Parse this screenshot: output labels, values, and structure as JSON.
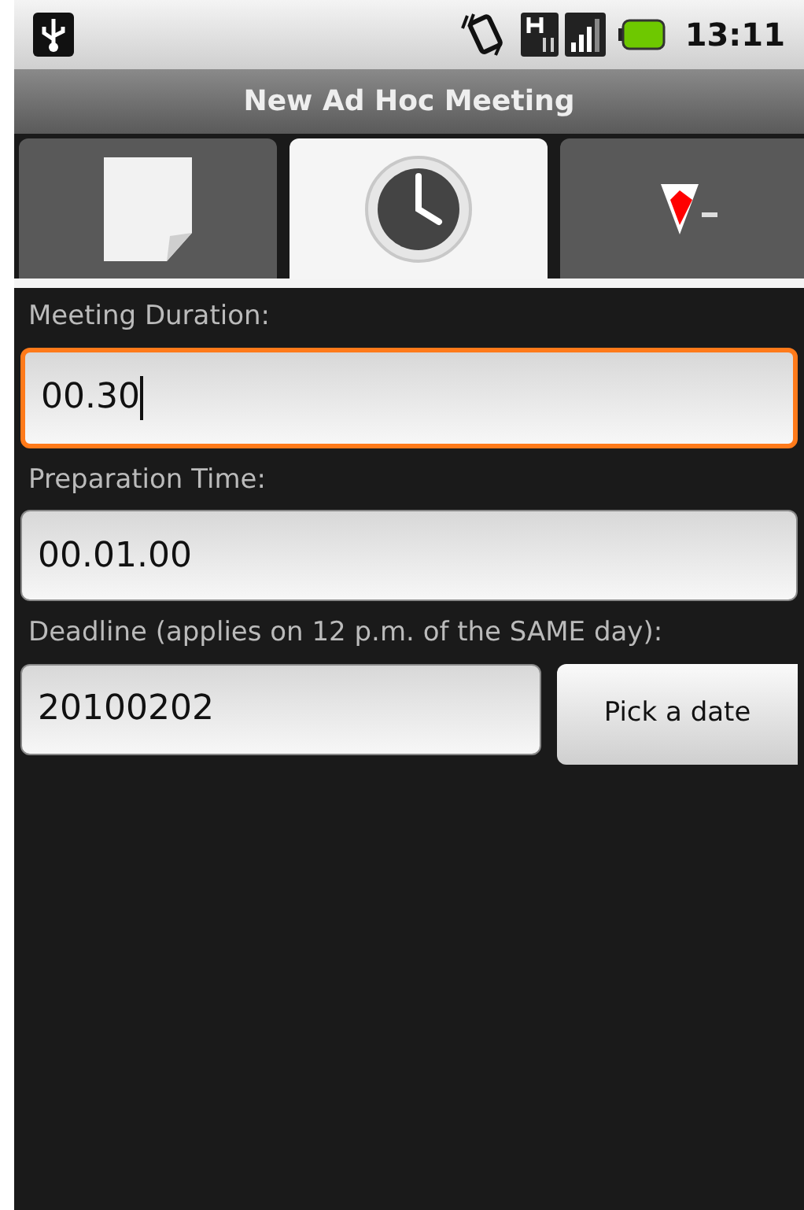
{
  "status_bar": {
    "time": "13:11"
  },
  "window": {
    "title": "New Ad Hoc Meeting"
  },
  "tabs": [
    {
      "kind": "document",
      "selected": false
    },
    {
      "kind": "clock",
      "selected": true
    },
    {
      "kind": "pin",
      "selected": false
    }
  ],
  "fields": [
    {
      "label": "Meeting Duration:",
      "value": "00.30",
      "focused": true
    },
    {
      "label": "Preparation Time:",
      "value": "00.01.00",
      "focused": false
    },
    {
      "label": "Deadline (applies on 12 p.m. of the SAME day):",
      "value": "20100202",
      "focused": false,
      "button": "Pick a date"
    }
  ]
}
